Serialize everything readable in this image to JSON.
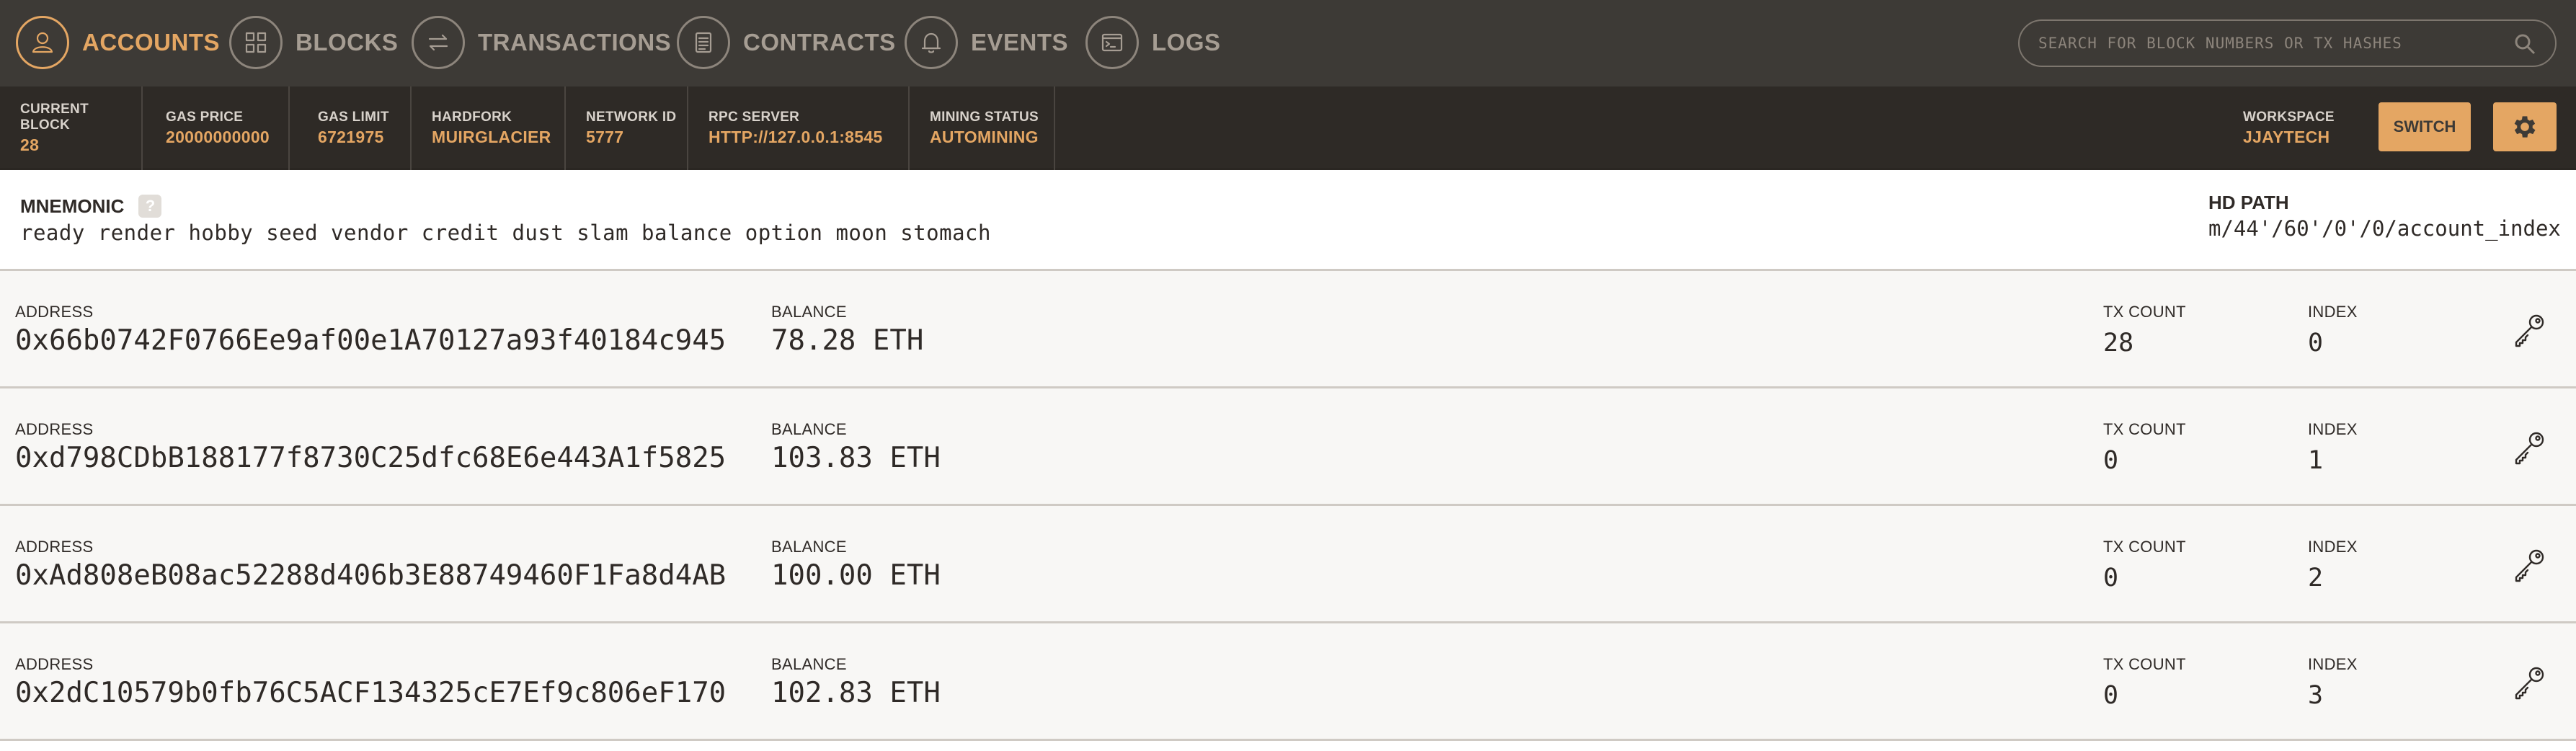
{
  "nav": {
    "items": [
      {
        "label": "ACCOUNTS",
        "icon": "user-icon",
        "active": true
      },
      {
        "label": "BLOCKS",
        "icon": "grid-icon",
        "active": false
      },
      {
        "label": "TRANSACTIONS",
        "icon": "arrows-swap-icon",
        "active": false
      },
      {
        "label": "CONTRACTS",
        "icon": "document-icon",
        "active": false
      },
      {
        "label": "EVENTS",
        "icon": "bell-icon",
        "active": false
      },
      {
        "label": "LOGS",
        "icon": "terminal-icon",
        "active": false
      }
    ],
    "search_placeholder": "SEARCH FOR BLOCK NUMBERS OR TX HASHES"
  },
  "status": {
    "current_block": {
      "label": "CURRENT BLOCK",
      "value": "28"
    },
    "gas_price": {
      "label": "GAS PRICE",
      "value": "20000000000"
    },
    "gas_limit": {
      "label": "GAS LIMIT",
      "value": "6721975"
    },
    "hardfork": {
      "label": "HARDFORK",
      "value": "MUIRGLACIER"
    },
    "network_id": {
      "label": "NETWORK ID",
      "value": "5777"
    },
    "rpc_server": {
      "label": "RPC SERVER",
      "value": "HTTP://127.0.0.1:8545"
    },
    "mining_status": {
      "label": "MINING STATUS",
      "value": "AUTOMINING"
    },
    "workspace": {
      "label": "WORKSPACE",
      "value": "JJAYTECH"
    },
    "switch_label": "SWITCH"
  },
  "mnemonic": {
    "label": "MNEMONIC",
    "help": "?",
    "words": "ready render hobby seed vendor credit dust slam balance option moon stomach",
    "hd_path_label": "HD PATH",
    "hd_path": "m/44'/60'/0'/0/account_index"
  },
  "accounts": {
    "address_label": "ADDRESS",
    "balance_label": "BALANCE",
    "tx_count_label": "TX COUNT",
    "index_label": "INDEX",
    "rows": [
      {
        "address": "0x66b0742F0766Ee9af00e1A70127a93f40184c945",
        "balance": "78.28 ETH",
        "tx_count": "28",
        "index": "0"
      },
      {
        "address": "0xd798CDbB188177f8730C25dfc68E6e443A1f5825",
        "balance": "103.83 ETH",
        "tx_count": "0",
        "index": "1"
      },
      {
        "address": "0xAd808eB08ac52288d406b3E88749460F1Fa8d4AB",
        "balance": "100.00 ETH",
        "tx_count": "0",
        "index": "2"
      },
      {
        "address": "0x2dC10579b0fb76C5ACF134325cE7Ef9c806eF170",
        "balance": "102.83 ETH",
        "tx_count": "0",
        "index": "3"
      }
    ]
  },
  "colors": {
    "accent": "#e4a663",
    "nav_bg": "#3d3a36",
    "status_bg": "#2e2a26",
    "row_bg": "#f8f7f5"
  }
}
